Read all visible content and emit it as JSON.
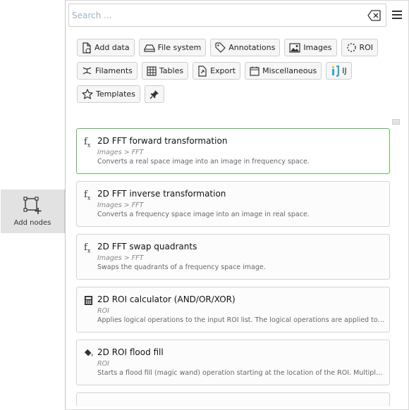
{
  "dock_tab": {
    "label": "Add nodes",
    "icon": "add-nodes-icon"
  },
  "search": {
    "placeholder": "Search ...",
    "value": ""
  },
  "categories": [
    {
      "label": "Add data",
      "icon": "file-add-icon"
    },
    {
      "label": "File system",
      "icon": "drive-icon"
    },
    {
      "label": "Annotations",
      "icon": "tag-icon"
    },
    {
      "label": "Images",
      "icon": "image-icon"
    },
    {
      "label": "ROI",
      "icon": "roi-icon"
    },
    {
      "label": "Filaments",
      "icon": "filaments-icon"
    },
    {
      "label": "Tables",
      "icon": "table-icon"
    },
    {
      "label": "Export",
      "icon": "export-icon"
    },
    {
      "label": "Miscellaneous",
      "icon": "calendar-icon"
    },
    {
      "label": "IJ",
      "icon": "imagej-icon"
    },
    {
      "label": "Templates",
      "icon": "star-icon"
    },
    {
      "label": "",
      "icon": "pin-icon"
    }
  ],
  "nodes": [
    {
      "title": "2D FFT forward transformation",
      "path": "Images > FFT",
      "desc": "Converts a real space image into an image in frequency space.",
      "icon": "function-icon",
      "selected": true
    },
    {
      "title": "2D FFT inverse transformation",
      "path": "Images > FFT",
      "desc": "Converts a frequency space image into an image in real space.",
      "icon": "function-icon"
    },
    {
      "title": "2D FFT swap quadrants",
      "path": "Images > FFT",
      "desc": "Swaps the quadrants of a frequency space image.",
      "icon": "function-icon"
    },
    {
      "title": "2D ROI calculator (AND/OR/XOR)",
      "path": "ROI",
      "desc": "Applies logical operations to the input ROI list. The logical operations are applied to the whole list, meaning that an AND operation will create the intersection of all ROI in the list.",
      "icon": "calculator-icon"
    },
    {
      "title": "2D ROI flood fill",
      "path": "ROI",
      "desc": "Starts a flood fill (magic wand) operation starting at the location of the ROI. Multiple ROI will create multiple flood fills.",
      "icon": "paint-bucket-icon"
    }
  ],
  "colors": {
    "selected_border": "#5cb85c",
    "placeholder": "#9fb3c8",
    "imagej_accent": "#29a8e0"
  }
}
